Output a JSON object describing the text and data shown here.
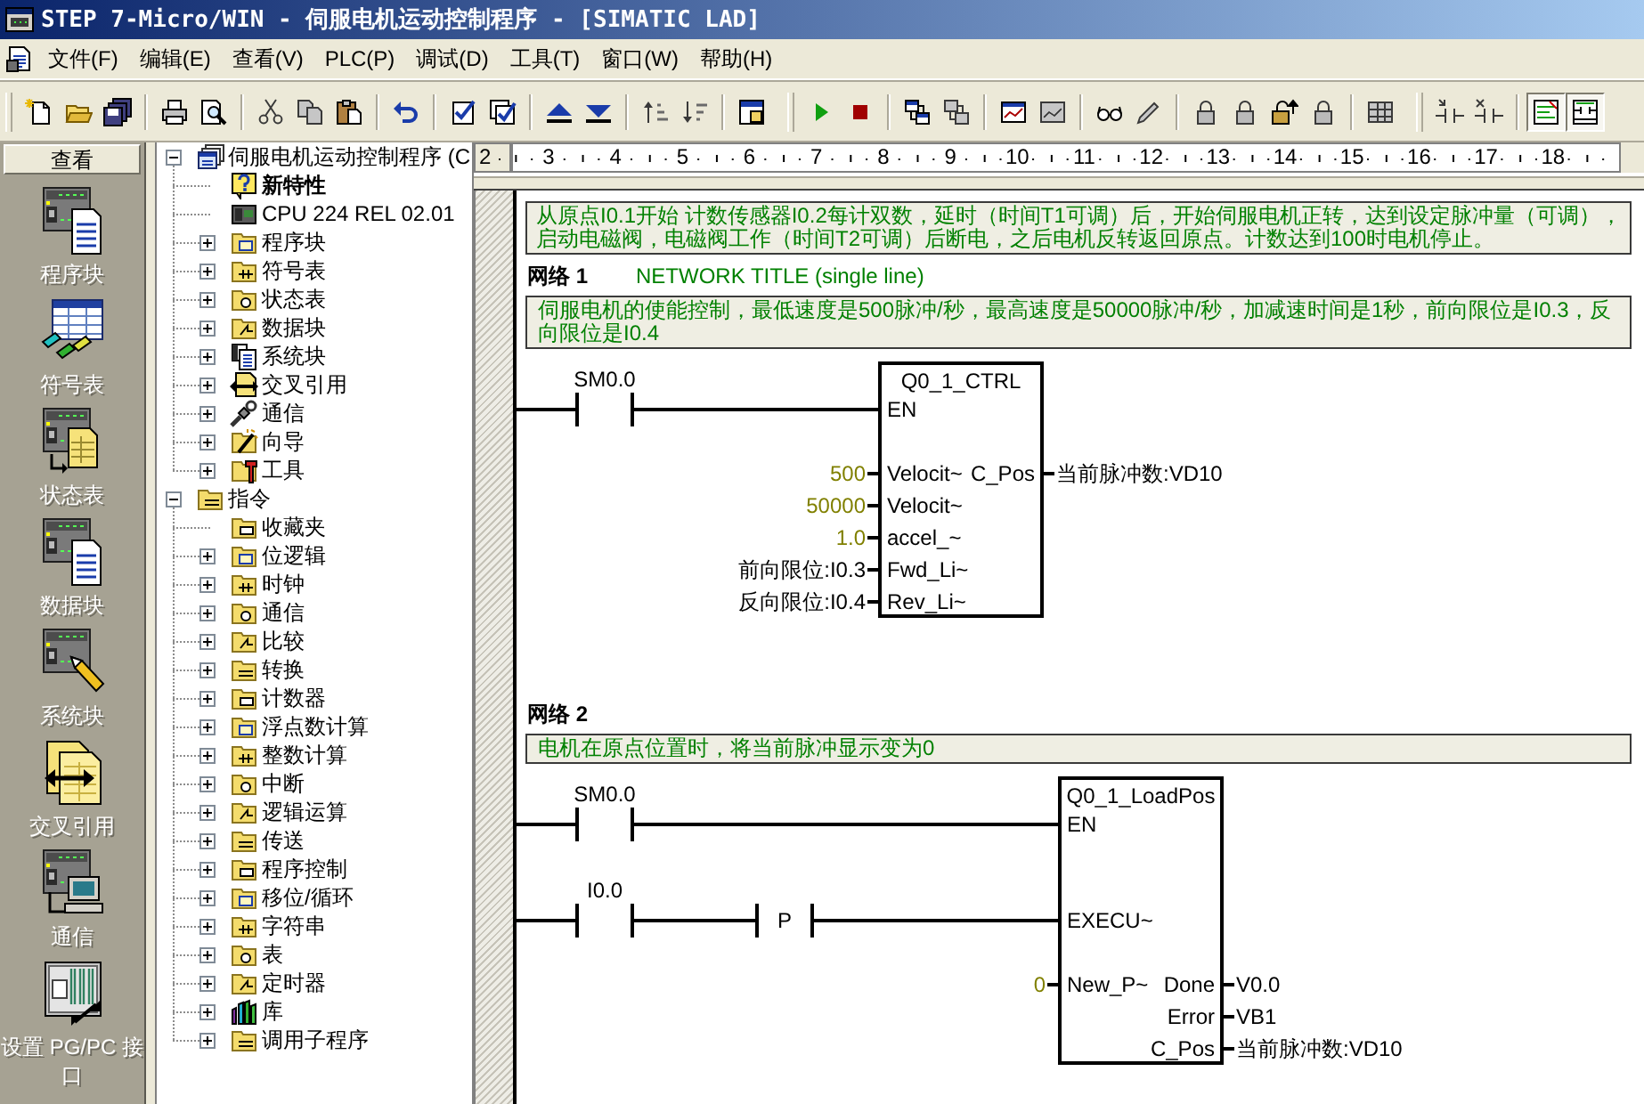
{
  "window": {
    "title": "STEP 7-Micro/WIN - 伺服电机运动控制程序 - [SIMATIC LAD]"
  },
  "menu": [
    "文件(F)",
    "编辑(E)",
    "查看(V)",
    "PLC(P)",
    "调试(D)",
    "工具(T)",
    "窗口(W)",
    "帮助(H)"
  ],
  "toolbars": [
    [
      [
        {
          "disabled": false,
          "pressed": false
        },
        {
          "disabled": false,
          "pressed": false
        },
        {
          "disabled": false,
          "pressed": false
        }
      ],
      [
        {
          "disabled": false,
          "pressed": false
        },
        {
          "disabled": false,
          "pressed": false
        }
      ],
      [
        {
          "disabled": true,
          "pressed": false
        },
        {
          "disabled": true,
          "pressed": false
        },
        {
          "disabled": false,
          "pressed": false
        }
      ],
      [
        {
          "disabled": false,
          "pressed": false
        }
      ],
      [
        {
          "disabled": false,
          "pressed": false
        },
        {
          "disabled": false,
          "pressed": false
        }
      ],
      [
        {
          "disabled": false,
          "pressed": false
        },
        {
          "disabled": false,
          "pressed": false
        }
      ],
      [
        {
          "disabled": true,
          "pressed": false
        },
        {
          "disabled": true,
          "pressed": false
        }
      ],
      [
        {
          "disabled": false,
          "pressed": false
        }
      ]
    ],
    [
      [
        {
          "disabled": false,
          "pressed": false
        },
        {
          "disabled": false,
          "pressed": false
        }
      ],
      [
        {
          "disabled": false,
          "pressed": false
        },
        {
          "disabled": true,
          "pressed": false
        }
      ],
      [
        {
          "disabled": false,
          "pressed": false
        },
        {
          "disabled": true,
          "pressed": false
        }
      ],
      [
        {
          "disabled": false,
          "pressed": false
        },
        {
          "disabled": true,
          "pressed": false
        }
      ],
      [
        {
          "disabled": true,
          "pressed": false
        },
        {
          "disabled": true,
          "pressed": false
        },
        {
          "disabled": false,
          "pressed": false
        },
        {
          "disabled": true,
          "pressed": false
        }
      ],
      [
        {
          "disabled": true,
          "pressed": false
        }
      ]
    ],
    [
      [
        {
          "disabled": true,
          "pressed": false
        },
        {
          "disabled": true,
          "pressed": false
        }
      ],
      [
        {
          "disabled": false,
          "pressed": true
        },
        {
          "disabled": false,
          "pressed": true
        }
      ]
    ]
  ],
  "navigation_bar": {
    "header": "查看",
    "items": [
      "程序块",
      "符号表",
      "状态表",
      "数据块",
      "系统块",
      "交叉引用",
      "通信",
      "设置 PG/PC 接口"
    ]
  },
  "tree": [
    {
      "label": "伺服电机运动控制程序 (C",
      "kind": "project",
      "expanded": true,
      "children": [
        {
          "label": "新特性",
          "kind": "news"
        },
        {
          "label": "CPU 224 REL 02.01",
          "kind": "cpu"
        },
        {
          "label": "程序块",
          "kind": "folder",
          "expanded": false
        },
        {
          "label": "符号表",
          "kind": "folder",
          "expanded": false
        },
        {
          "label": "状态表",
          "kind": "folder",
          "expanded": false
        },
        {
          "label": "数据块",
          "kind": "folder",
          "expanded": false
        },
        {
          "label": "系统块",
          "kind": "documents",
          "expanded": false
        },
        {
          "label": "交叉引用",
          "kind": "reference",
          "expanded": false
        },
        {
          "label": "通信",
          "kind": "connection",
          "expanded": false
        },
        {
          "label": "向导",
          "kind": "wizard",
          "expanded": false
        },
        {
          "label": "工具",
          "kind": "tools",
          "expanded": false
        }
      ]
    },
    {
      "label": "指令",
      "kind": "folder",
      "expanded": true,
      "children": [
        {
          "label": "收藏夹",
          "kind": "folder"
        },
        {
          "label": "位逻辑",
          "kind": "folder",
          "expanded": false
        },
        {
          "label": "时钟",
          "kind": "folder",
          "expanded": false
        },
        {
          "label": "通信",
          "kind": "folder",
          "expanded": false
        },
        {
          "label": "比较",
          "kind": "folder",
          "expanded": false
        },
        {
          "label": "转换",
          "kind": "folder",
          "expanded": false
        },
        {
          "label": "计数器",
          "kind": "folder",
          "expanded": false
        },
        {
          "label": "浮点数计算",
          "kind": "folder",
          "expanded": false
        },
        {
          "label": "整数计算",
          "kind": "folder",
          "expanded": false
        },
        {
          "label": "中断",
          "kind": "folder",
          "expanded": false
        },
        {
          "label": "逻辑运算",
          "kind": "folder",
          "expanded": false
        },
        {
          "label": "传送",
          "kind": "folder",
          "expanded": false
        },
        {
          "label": "程序控制",
          "kind": "folder",
          "expanded": false
        },
        {
          "label": "移位/循环",
          "kind": "folder",
          "expanded": false
        },
        {
          "label": "字符串",
          "kind": "folder",
          "expanded": false
        },
        {
          "label": "表",
          "kind": "folder",
          "expanded": false
        },
        {
          "label": "定时器",
          "kind": "folder",
          "expanded": false
        },
        {
          "label": "库",
          "kind": "library",
          "expanded": false
        },
        {
          "label": "调用子程序",
          "kind": "folder",
          "expanded": false
        }
      ]
    }
  ],
  "editor": {
    "ruler": {
      "row_header": "2",
      "columns": [
        "3",
        "4",
        "5",
        "6",
        "7",
        "8",
        "9",
        "10",
        "11",
        "12",
        "13",
        "14",
        "15",
        "16",
        "17",
        "18"
      ]
    },
    "program_comment": "从原点I0.1开始 计数传感器I0.2每计双数，延时（时间T1可调）后，开始伺服电机正转，达到设定脉冲量（可调），启动电磁阀，电磁阀工作（时间T2可调）后断电，之后电机反转返回原点。计数达到100时电机停止。",
    "networks": [
      {
        "label": "网络 1",
        "title": "NETWORK TITLE (single line)",
        "comment": "伺服电机的使能控制，最低速度是500脉冲/秒，最高速度是50000脉冲/秒，加减速时间是1秒，前向限位是I0.3，反向限位是I0.4",
        "rungs": [
          {
            "elements": [
              {
                "kind": "normally_open",
                "operand": "SM0.0"
              }
            ]
          }
        ],
        "block": {
          "name": "Q0_1_CTRL",
          "inputs": [
            {
              "pin": "EN"
            },
            {
              "pin": "Velocit~",
              "operand": "500",
              "kind": "constant"
            },
            {
              "pin": "Velocit~",
              "operand": "50000",
              "kind": "constant"
            },
            {
              "pin": "accel_~",
              "operand": "1.0",
              "kind": "constant"
            },
            {
              "pin": "Fwd_Li~",
              "operand": "前向限位:I0.3",
              "kind": "symbol"
            },
            {
              "pin": "Rev_Li~",
              "operand": "反向限位:I0.4",
              "kind": "symbol"
            }
          ],
          "outputs": [
            {
              "pin": "C_Pos",
              "operand": "当前脉冲数:VD10",
              "kind": "symbol"
            }
          ]
        }
      },
      {
        "label": "网络 2",
        "comment": "电机在原点位置时，将当前脉冲显示变为0",
        "rungs": [
          {
            "elements": [
              {
                "kind": "normally_open",
                "operand": "SM0.0"
              }
            ]
          },
          {
            "elements": [
              {
                "kind": "normally_open",
                "operand": "I0.0"
              },
              {
                "kind": "positive_transition",
                "label": "P"
              }
            ]
          }
        ],
        "block": {
          "name": "Q0_1_LoadPos",
          "inputs": [
            {
              "pin": "EN"
            },
            {
              "pin": "EXECU~"
            },
            {
              "pin": "New_P~",
              "operand": "0",
              "kind": "constant"
            }
          ],
          "outputs": [
            {
              "pin": "Done",
              "operand": "V0.0",
              "kind": "symbol"
            },
            {
              "pin": "Error",
              "operand": "VB1",
              "kind": "symbol"
            },
            {
              "pin": "C_Pos",
              "operand": "当前脉冲数:VD10",
              "kind": "symbol"
            }
          ]
        }
      }
    ]
  }
}
